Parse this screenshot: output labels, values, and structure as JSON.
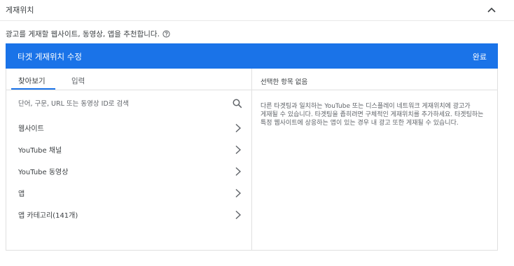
{
  "section": {
    "title": "게재위치",
    "collapse_icon": "chevron-up-icon"
  },
  "helper": {
    "text": "광고를 게재할 웹사이트, 동영상, 앱을 추천합니다.",
    "icon": "help-circle-icon"
  },
  "panel": {
    "title": "타겟 게재위치 수정",
    "done_label": "완료",
    "accent_color": "#1a73e8"
  },
  "tabs": [
    {
      "label": "찾아보기",
      "active": true
    },
    {
      "label": "입력",
      "active": false
    }
  ],
  "search": {
    "placeholder": "단어, 구문, URL 또는 동영상 ID로 검색",
    "value": "",
    "icon": "search-icon"
  },
  "categories": [
    {
      "label": "웹사이트"
    },
    {
      "label": "YouTube 채널"
    },
    {
      "label": "YouTube 동영상"
    },
    {
      "label": "앱"
    },
    {
      "label": "앱 카테고리(141개)"
    }
  ],
  "selection": {
    "header": "선택한 항목 없음",
    "description": "다른 타겟팅과 일치하는 YouTube 또는 디스플레이 네트워크 게재위치에 광고가 게재될 수 있습니다. 타겟팅을 좁히려면 구체적인 게재위치를 추가하세요. 타겟팅하는 특정 웹사이트에 상응하는 앱이 있는 경우 내 광고 또한 게재될 수 있습니다."
  }
}
